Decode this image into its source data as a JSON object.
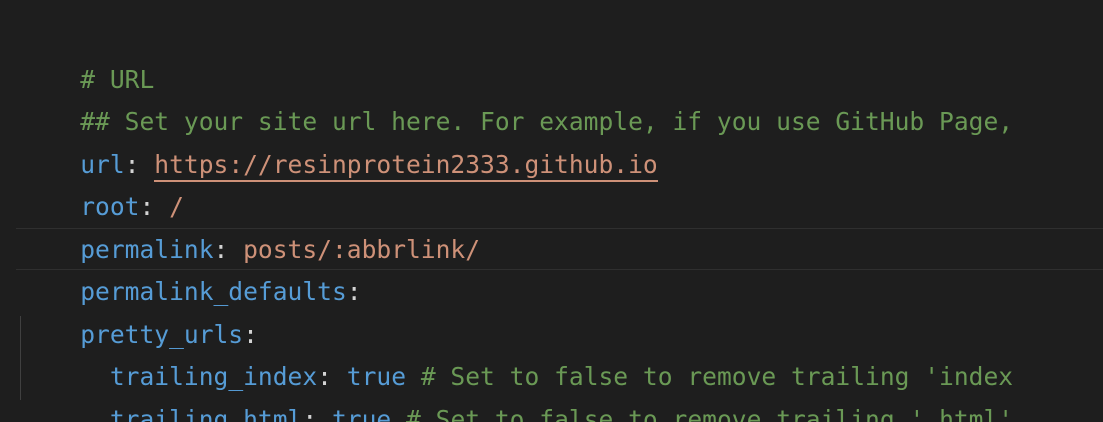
{
  "lines": [
    {
      "comment": "# URL"
    },
    {
      "comment": "## Set your site url here. For example, if you use GitHub Page,"
    },
    {
      "key": "url",
      "sep": ": ",
      "value": "https://resinprotein2333.github.io"
    },
    {
      "key": "root",
      "sep": ": ",
      "value": "/"
    },
    {
      "key": "permalink",
      "sep": ": ",
      "value": "posts/:abbrlink/"
    },
    {
      "key": "permalink_defaults",
      "sep": ":"
    },
    {
      "key": "pretty_urls",
      "sep": ":"
    },
    {
      "indent": "  ",
      "key": "trailing_index",
      "sep": ": ",
      "value": "true",
      "comment": " # Set to false to remove trailing 'index"
    },
    {
      "indent": "  ",
      "key": "trailing_html",
      "sep": ": ",
      "value": "true",
      "comment": " # Set to false to remove trailing '.html'"
    }
  ],
  "colors": {
    "background": "#1e1e1e",
    "comment": "#6a9955",
    "key": "#569cd6",
    "string": "#ce9178",
    "punctuation": "#d4d4d4"
  }
}
